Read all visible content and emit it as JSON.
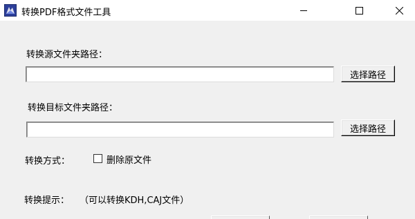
{
  "window": {
    "title": "转换PDF格式文件工具",
    "icon": "app-icon",
    "controls": [
      "minimize-icon",
      "maximize-icon",
      "close-icon"
    ]
  },
  "source": {
    "label": "转换源文件夹路径：",
    "value": "",
    "browse_label": "选择路径"
  },
  "target": {
    "label": "转换目标文件夹路径：",
    "value": "",
    "browse_label": "选择路径"
  },
  "mode": {
    "label": "转换方式：",
    "delete_original_label": "删除原文件",
    "delete_original_checked": false
  },
  "hint": {
    "label": "转换提示：",
    "text": "（可以转换KDH,CAJ文件）"
  },
  "colors": {
    "titlebar": "#ffffff",
    "client": "#f0f0f0"
  }
}
